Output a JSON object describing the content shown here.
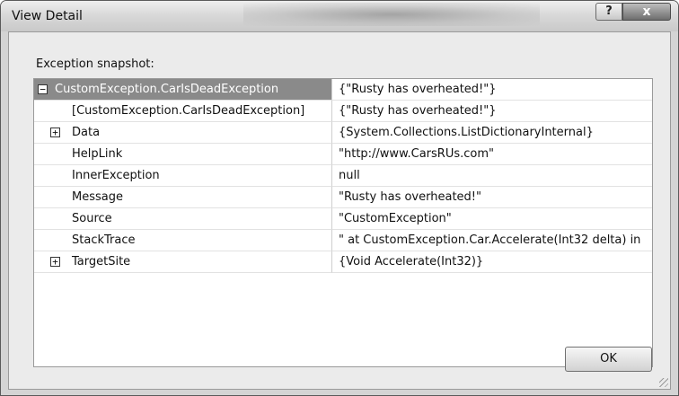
{
  "window": {
    "title": "View Detail",
    "help_glyph": "?",
    "close_glyph": "x"
  },
  "snapshot": {
    "label": "Exception snapshot:"
  },
  "rows": [
    {
      "name": "CustomException.CarIsDeadException",
      "value": "{\"Rusty has overheated!\"}",
      "expander": "−",
      "selected": true
    },
    {
      "name": "[CustomException.CarIsDeadException]",
      "value": "{\"Rusty has overheated!\"}",
      "expander": "",
      "selected": false
    },
    {
      "name": "Data",
      "value": "{System.Collections.ListDictionaryInternal}",
      "expander": "+",
      "selected": false
    },
    {
      "name": "HelpLink",
      "value": "\"http://www.CarsRUs.com\"",
      "expander": "",
      "selected": false
    },
    {
      "name": "InnerException",
      "value": "null",
      "expander": "",
      "selected": false
    },
    {
      "name": "Message",
      "value": "\"Rusty has overheated!\"",
      "expander": "",
      "selected": false
    },
    {
      "name": "Source",
      "value": "\"CustomException\"",
      "expander": "",
      "selected": false
    },
    {
      "name": "StackTrace",
      "value": "\"   at CustomException.Car.Accelerate(Int32 delta) in",
      "expander": "",
      "selected": false
    },
    {
      "name": "TargetSite",
      "value": "{Void Accelerate(Int32)}",
      "expander": "+",
      "selected": false
    }
  ],
  "buttons": {
    "ok_label": "OK"
  }
}
